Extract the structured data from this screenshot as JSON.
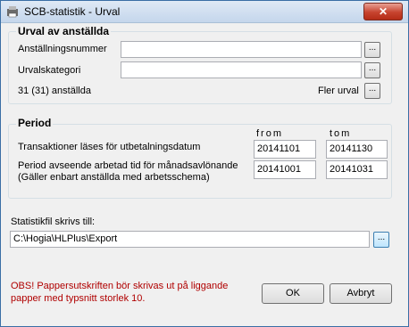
{
  "window": {
    "title": "SCB-statistik - Urval",
    "close_label": "✕"
  },
  "urval": {
    "heading": "Urval av anställda",
    "anstallningsnummer_label": "Anställningsnummer",
    "anstallningsnummer_value": "",
    "urvalskategori_label": "Urvalskategori",
    "urvalskategori_value": "",
    "count_text": "31 (31) anställda",
    "fler_urval_label": "Fler urval",
    "ellipsis": "..."
  },
  "period": {
    "heading": "Period",
    "from_header": "from",
    "tom_header": "tom",
    "row1_label": "Transaktioner läses för utbetalningsdatum",
    "row1_from": "20141101",
    "row1_tom": "20141130",
    "row2_label_line1": "Period avseende arbetad tid för månadsavlönande",
    "row2_label_line2": "(Gäller enbart anställda med arbetsschema)",
    "row2_from": "20141001",
    "row2_tom": "20141031"
  },
  "export": {
    "label": "Statistikfil skrivs till:",
    "path": "C:\\Hogia\\HLPlus\\Export",
    "ellipsis": "..."
  },
  "footer": {
    "warning_line1": "OBS! Pappersutskriften bör skrivas ut på liggande",
    "warning_line2": "papper med typsnitt storlek 10.",
    "ok_label": "OK",
    "cancel_label": "Avbryt"
  },
  "colors": {
    "warning": "#b00000",
    "titlebar": "#c4d6ec"
  }
}
